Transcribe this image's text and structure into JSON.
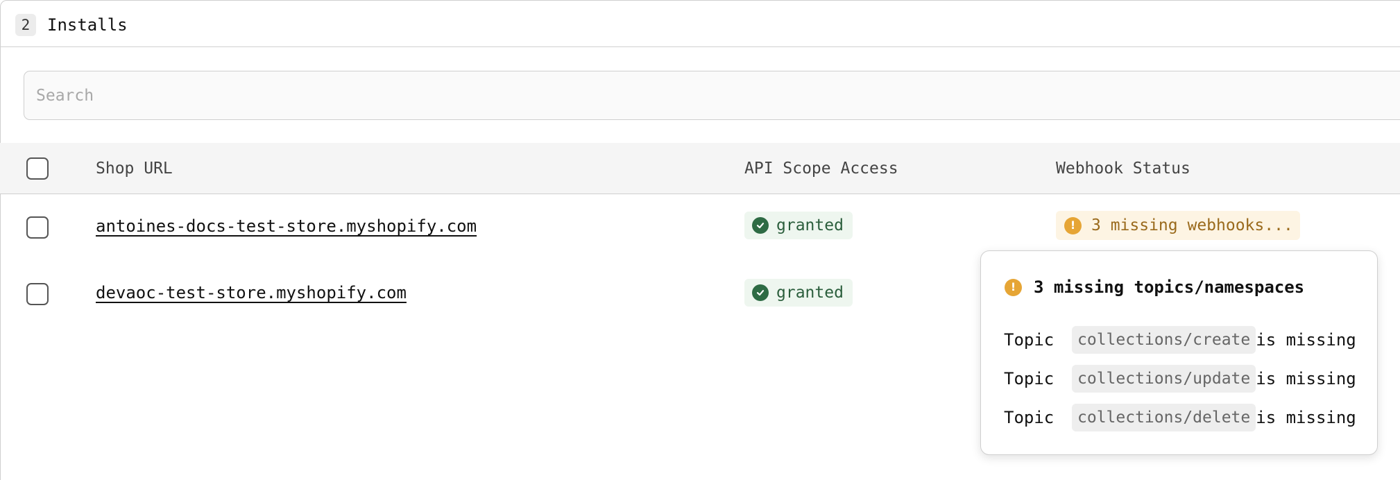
{
  "header": {
    "count": "2",
    "title": "Installs"
  },
  "search": {
    "placeholder": "Search",
    "value": ""
  },
  "table": {
    "columns": {
      "shop_url": "Shop URL",
      "api_scope": "API Scope Access",
      "webhook": "Webhook Status"
    },
    "rows": [
      {
        "shop_url": "antoines-docs-test-store.myshopify.com",
        "api_scope": "granted",
        "webhook_status": "3 missing webhooks..."
      },
      {
        "shop_url": "devaoc-test-store.myshopify.com",
        "api_scope": "granted"
      }
    ]
  },
  "popover": {
    "title": "3 missing topics/namespaces",
    "items": [
      {
        "prefix": "Topic",
        "code": "collections/create",
        "suffix": "is missing"
      },
      {
        "prefix": "Topic",
        "code": "collections/update",
        "suffix": "is missing"
      },
      {
        "prefix": "Topic",
        "code": "collections/delete",
        "suffix": "is missing"
      }
    ]
  },
  "colors": {
    "granted_bg": "#eef6ef",
    "granted_text": "#2b5e3c",
    "warning_bg": "#fdf4e3",
    "warning_icon": "#e6a535",
    "warning_text": "#9a6a1c"
  },
  "icons": {
    "granted": "check-circle-icon",
    "warning": "exclamation-circle-icon"
  }
}
